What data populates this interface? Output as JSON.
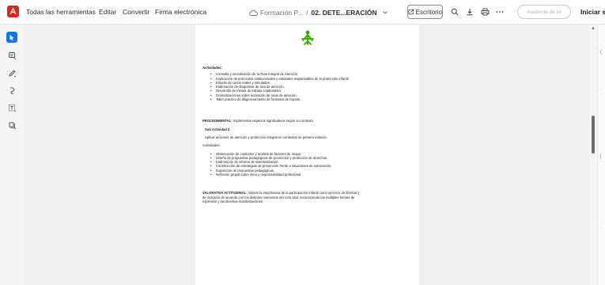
{
  "toolbar": {
    "menu": [
      "Todas las herramientas",
      "Editar",
      "Convertir",
      "Firma electrónica"
    ],
    "cloud_label": "Formación P...",
    "path_sep": "/",
    "file_name": "02. DETE...ERACIÓN",
    "escritorio_label": "Escritorio",
    "assistant_label": "Asistente de IA",
    "signin_label": "Iniciar ses"
  },
  "icons": {
    "logo": "adobe-acrobat-logo",
    "cloud": "cloud-icon",
    "chevron": "chevron-down-icon",
    "search": "search-icon",
    "download": "download-icon",
    "print": "print-icon",
    "more": "more-icon",
    "external": "external-window-icon"
  },
  "colors": {
    "brand": "#d7281c",
    "rail_active": "#1473e6",
    "sena_green": "#39a900"
  },
  "document": {
    "actividades_heading": "Actividades:",
    "list1": [
      "Consulta y socialización de la Ruta Integral de Atención.",
      "Explicación de protocolos institucionales y entidades responsables de la protección infantil.",
      "Estudio de casos reales y simulados.",
      "Elaboración de diagramas de ruta de atención.",
      "Desarrollo de mesas de trabajo colaborativo.",
      "Dramatizaciones sobre activación de rutas de atención.",
      "Taller práctico de diligenciamiento de formatos de reporte."
    ],
    "procedimental_label": "PROCEDIMENTAL:",
    "procedimental_text": "Implementar espacios significativos según su contexto.",
    "sub_actividad": "Sub Actividad 3",
    "sub_actividad_text": "Aplicar acciones de atención y protección integral en contextos de primera infancia.",
    "actividades2_heading": "Actividades:",
    "list2": [
      "Observación de contextos y análisis de factores de riesgo.",
      "Diseño de propuestas pedagógicas de promoción y protección de derechos.",
      "Elaboración de informe de sistematización.",
      "Construcción de estrategias de prevención frente a situaciones de vulneración.",
      "Exposición de propuestas pedagógicas.",
      "Reflexión grupal sobre ética y responsabilidad profesional."
    ],
    "valorativa_label": "VALORATIVA ACTITUDINAL:",
    "valorativa_line1": "Valorar la importancia de la participación infantil como ejercicio de libertad y",
    "valorativa_line2": "de inclusión de acuerdo con los distintos momentos del ciclo vital, reconociendo las múltiples formas de",
    "valorativa_line3": "expresión y las diversas manifestaciones."
  }
}
